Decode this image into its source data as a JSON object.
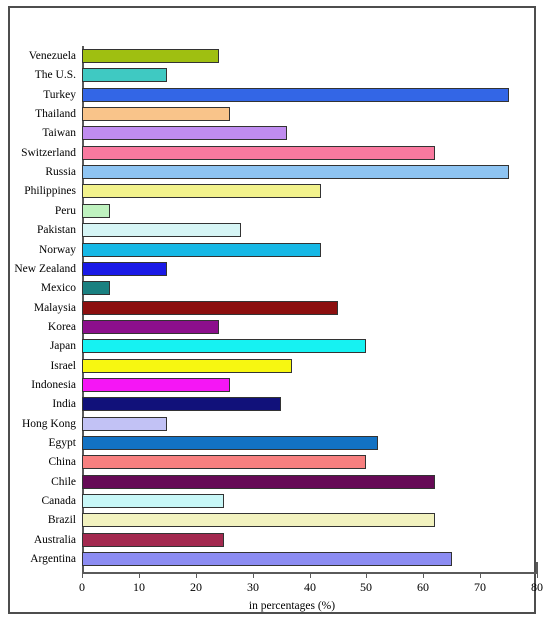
{
  "chart_data": {
    "type": "bar",
    "orientation": "horizontal",
    "title": "",
    "xlabel": "in percentages (%)",
    "ylabel": "",
    "xlim": [
      0,
      80
    ],
    "xticks": [
      0,
      10,
      20,
      30,
      40,
      50,
      60,
      70,
      80
    ],
    "grid": false,
    "legend": null,
    "categories": [
      "Venezuela",
      "The U.S.",
      "Turkey",
      "Thailand",
      "Taiwan",
      "Switzerland",
      "Russia",
      "Philippines",
      "Peru",
      "Pakistan",
      "Norway",
      "New Zealand",
      "Mexico",
      "Malaysia",
      "Korea",
      "Japan",
      "Israel",
      "Indonesia",
      "India",
      "Hong Kong",
      "Egypt",
      "China",
      "Chile",
      "Canada",
      "Brazil",
      "Australia",
      "Argentina"
    ],
    "values": [
      24,
      15,
      75,
      26,
      36,
      62,
      75,
      42,
      5,
      28,
      42,
      15,
      5,
      45,
      24,
      50,
      37,
      26,
      35,
      15,
      52,
      50,
      62,
      25,
      62,
      25,
      65
    ],
    "colors": [
      "#9fbf11",
      "#3fc9c2",
      "#3366e6",
      "#f9c48a",
      "#c08cf0",
      "#f9799f",
      "#8ec4f2",
      "#f2f28c",
      "#bff2bf",
      "#d6f5f5",
      "#16b8e6",
      "#1a1ae6",
      "#1a8080",
      "#8c0f0f",
      "#8c0f8c",
      "#16f2f2",
      "#f7f711",
      "#f516f5",
      "#11117a",
      "#c2c2f5",
      "#1272c4",
      "#f77f7f",
      "#660a56",
      "#c8f7f7",
      "#f2f2bf",
      "#a3294f",
      "#8c8cf2"
    ],
    "bar_edge_color": "#333333",
    "axis_color": "#5a5a5a",
    "frame_color": "#4d4d4d",
    "background": "#ffffff"
  }
}
